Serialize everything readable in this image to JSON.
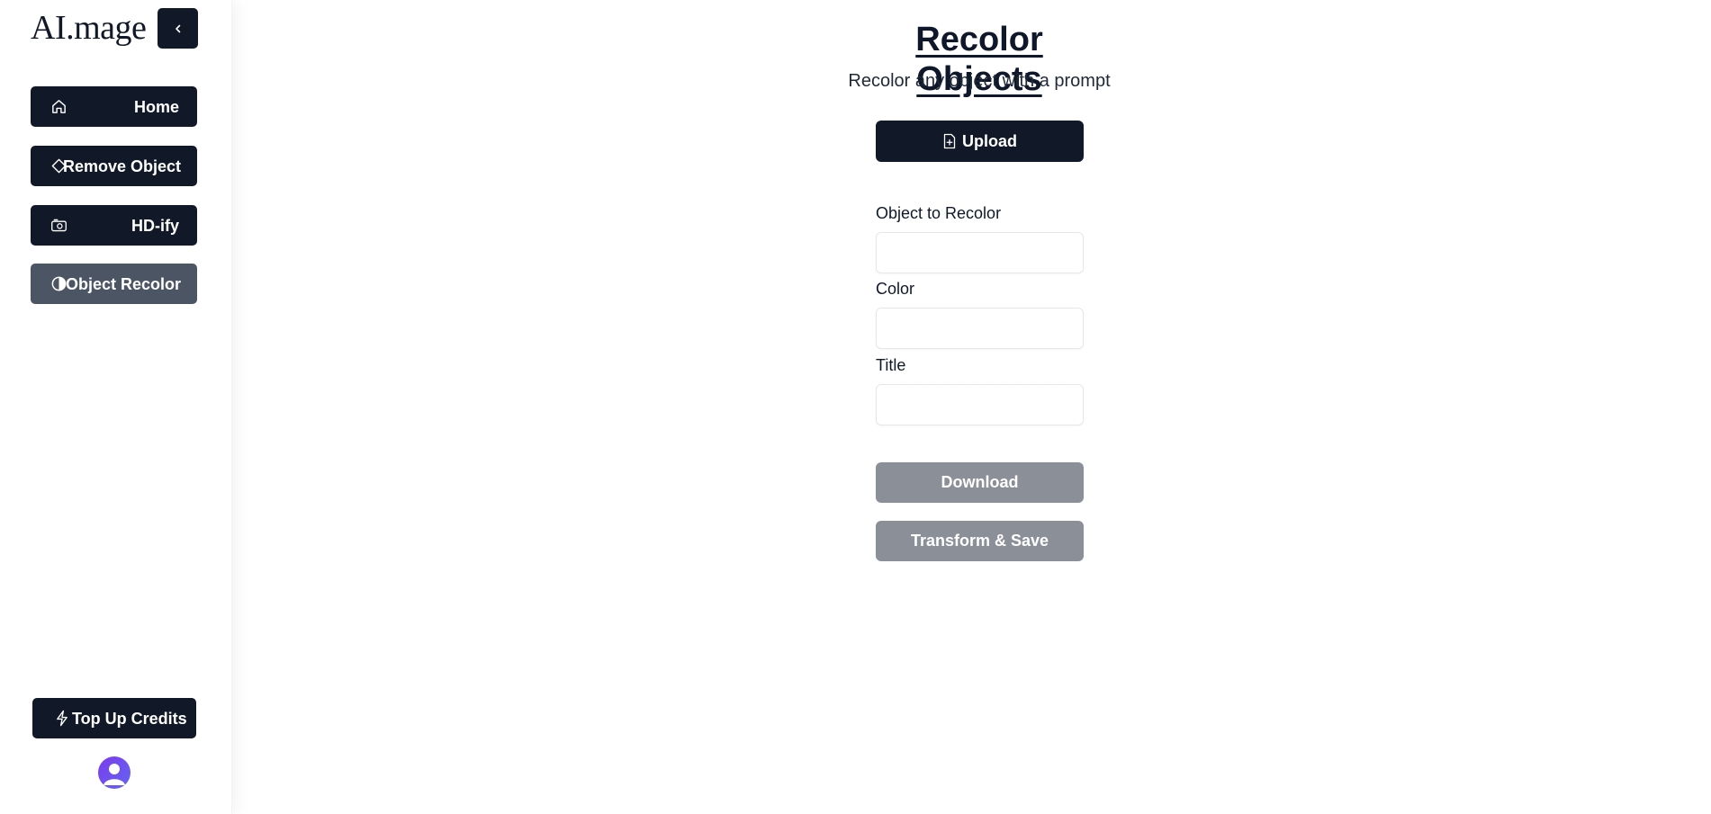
{
  "brand": {
    "name": "AI.mage"
  },
  "sidebar": {
    "collapse_icon": "chevron-left-icon",
    "items": [
      {
        "label": "Home",
        "icon": "home-icon",
        "active": false
      },
      {
        "label": "Remove Object",
        "icon": "eraser-icon",
        "active": false
      },
      {
        "label": "HD-ify",
        "icon": "camera-icon",
        "active": false
      },
      {
        "label": "Object Recolor",
        "icon": "contrast-icon",
        "active": true
      }
    ],
    "topup": {
      "label": "Top Up Credits",
      "icon": "lightning-icon"
    },
    "avatar_icon": "user-avatar-icon"
  },
  "main": {
    "title": "Recolor Objects",
    "subtitle": "Recolor any object with a prompt",
    "upload": {
      "label": "Upload",
      "icon": "file-plus-icon"
    },
    "fields": [
      {
        "label": "Object to Recolor",
        "value": "",
        "placeholder": ""
      },
      {
        "label": "Color",
        "value": "",
        "placeholder": ""
      },
      {
        "label": "Title",
        "value": "",
        "placeholder": ""
      }
    ],
    "download_label": "Download",
    "transform_label": "Transform & Save"
  },
  "colors": {
    "primary": "#111827",
    "active_nav": "#4b5563",
    "disabled_button": "#8a8f98",
    "avatar": "#6d5cf0"
  }
}
